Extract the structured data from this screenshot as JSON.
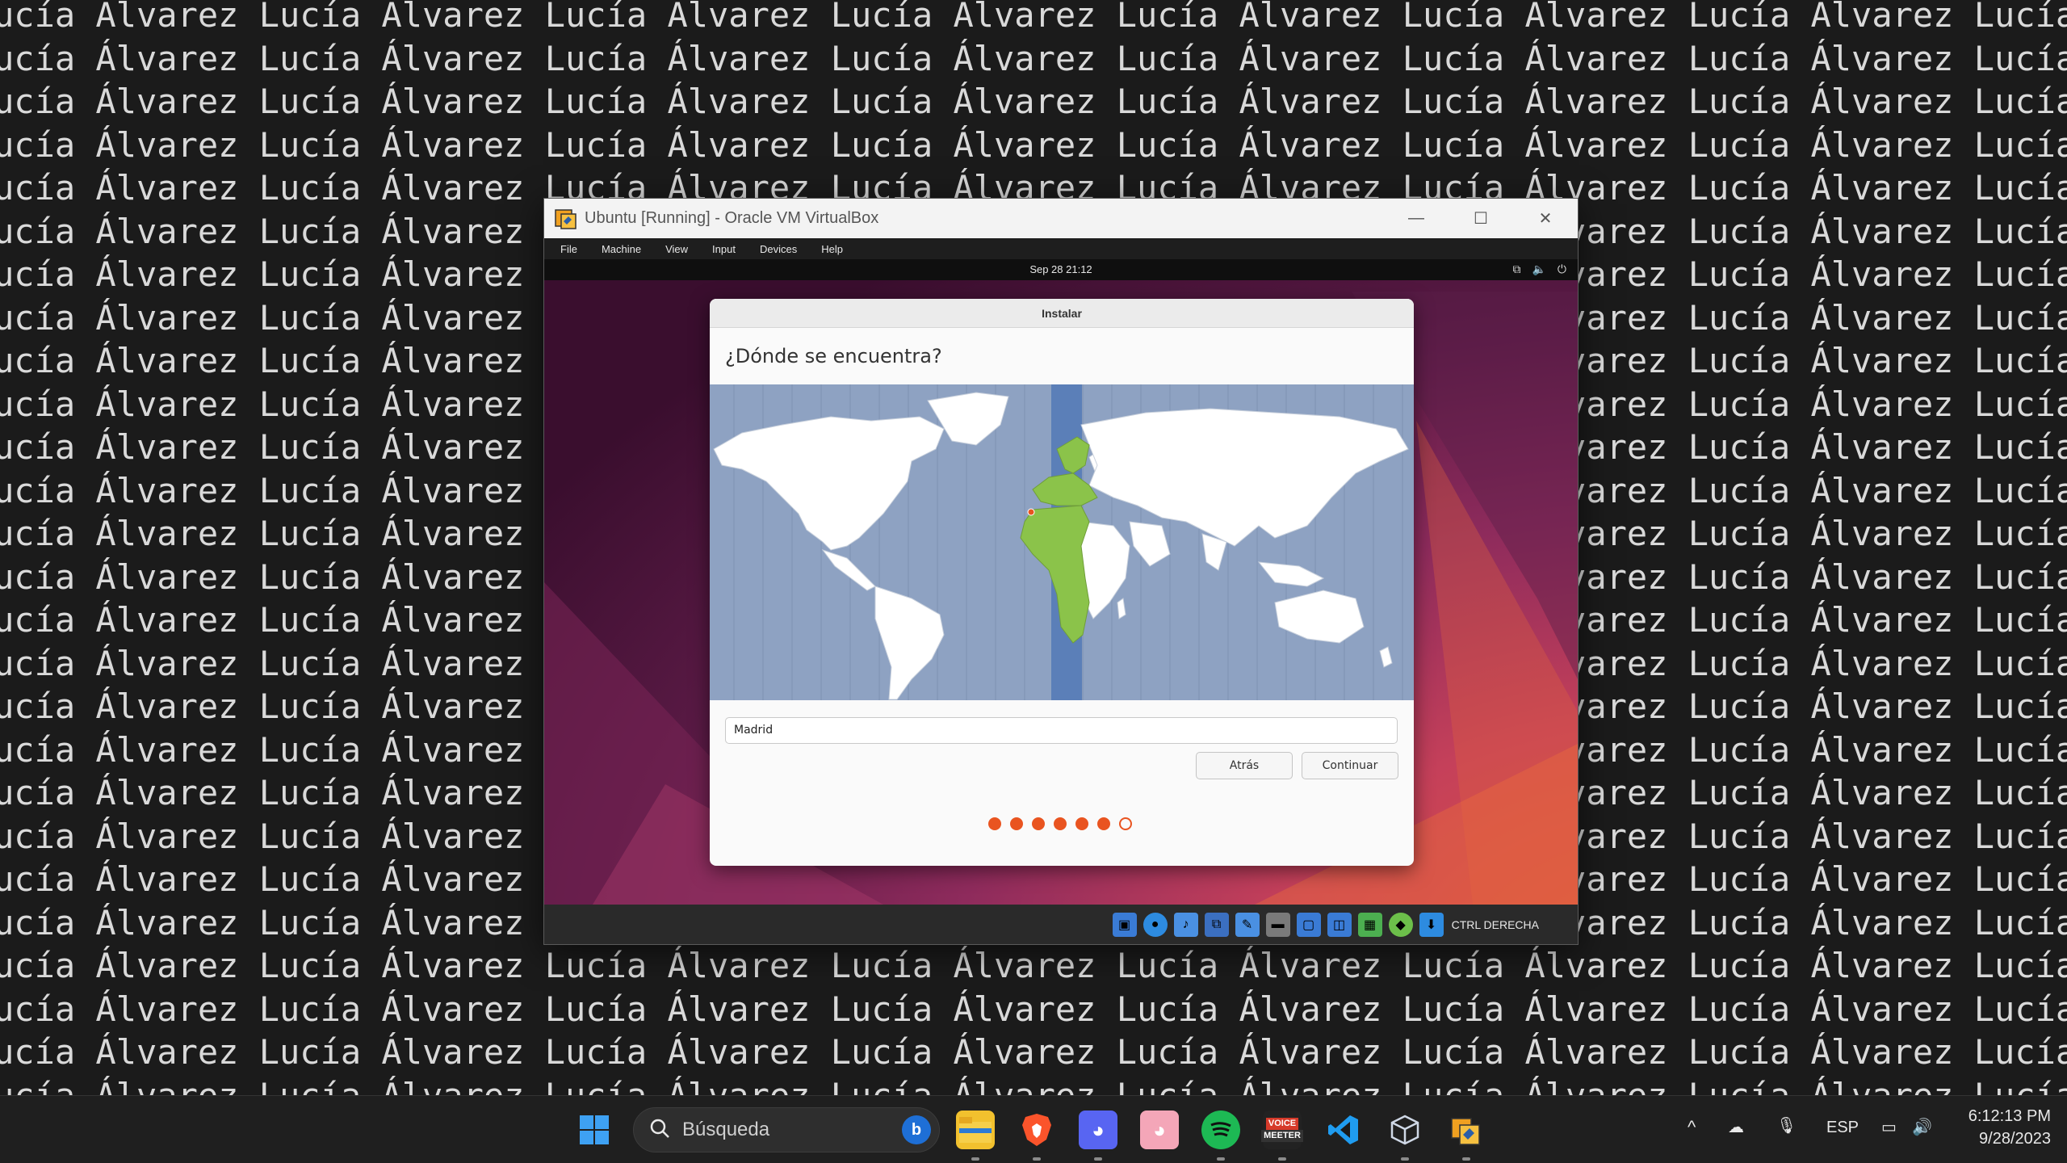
{
  "wallpaper": {
    "rows": [
      "ucía Álvarez Lucía Álvarez Lucía Álvarez Lucía Álvarez Lucía Álvarez Lucía Álvarez Lucía Álvarez Lucía Álvar",
      "ucía Álvarez Lucía Álvarez Lucía Álvarez Lucía Álvarez Lucía Álvarez Lucía Álvarez Lucía Álvarez Lucía Álvare",
      "ucía Álvarez Lucía Álvarez Lucía Álvarez Lucía Álvarez Lucía Álvarez Lucía Álvarez Lucía Álvarez Lucía Álvare",
      "ucía Álvarez Lucía Álvarez Lucía Álvarez Lucía Álvarez Lucía Álvarez Lucía Álvarez Lucía Álvarez Lucía Álvare",
      "ucía Álvarez Lucía Álvarez Lucía Álvarez Lucía Álvarez Lucía Álvarez Lucía Álvarez Lucía Álvarez Lucía Álvare",
      "ucía Álvarez Lucía Álvarez Lucía Álvarez Lucía Álvarez Lucía Álvarez Lucía Álvarez Lucía Álvarez Lucía Álvare",
      "ucía Álvarez Lucía Álvarez Lucía Álvarez Lucía Álvarez Lucía Álvarez Lucía Álvarez Lucía Álvarez Lucía Álvare",
      "ucía Álvarez Lucía Álvarez Lucía Álvarez Lucía Álvarez Lucía Álvarez Lucía Álvarez Lucía Álvarez Lucía Álvare",
      "ucía Álvarez Lucía Álvarez Lucía Álvarez Lucía Álvarez Lucía Álvarez Lucía Álvarez Lucía Álvarez Lucía Álvare",
      "ucía Álvarez Lucía Álvarez Lucía Álvarez Lucía Álvarez Lucía Álvarez Lucía Álvarez Lucía Álvarez Lucía Álvare",
      "ucía Álvarez Lucía Álvarez Lucía Álvarez Lucía Álvarez Lucía Álvarez Lucía Álvarez Lucía Álvarez Lucía Álvare",
      "ucía Álvarez Lucía Álvarez Lucía Álvarez Lucía Álvarez Lucía Álvarez Lucía Álvarez Lucía Álvarez Lucía Álvare",
      "ucía Álvarez Lucía Álvarez Lucía Álvarez Lucía Álvarez Lucía Álvarez Lucía Álvarez Lucía Álvarez Lucía Álvare",
      "ucía Álvarez Lucía Álvarez Lucía Álvarez Lucía Álvarez Lucía Álvarez Lucía Álvarez Lucía Álvarez Lucía Álvare",
      "ucía Álvarez Lucía Álvarez Lucía Álvarez Lucía Álvarez Lucía Álvarez Lucía Álvarez Lucía Álvarez Lucía Álvare",
      "ucía Álvarez Lucía Álvarez Lucía Álvarez Lucía Álvarez Lucía Álvarez Lucía Álvarez Lucía Álvarez Lucía Álvare",
      "ucía Álvarez Lucía Álvarez Lucía Álvarez Lucía Álvarez Lucía Álvarez Lucía Álvarez Lucía Álvarez Lucía Álvare",
      "ucía Álvarez Lucía Álvarez Lucía Álvarez Lucía Álvarez Lucía Álvarez Lucía Álvarez Lucía Álvarez Lucía Álvare",
      "ucía Álvarez Lucía Álvarez Lucía Álvarez Lucía Álvarez Lucía Álvarez Lucía Álvarez Lucía Álvarez Lucía Álvare",
      "ucía Álvarez Lucía Álvarez Lucía Álvarez Lucía Álvarez Lucía Álvarez Lucía Álvarez Lucía Álvarez Lucía Álvare",
      "ucía Álvarez Lucía Álvarez Lucía Álvarez Lucía Álvarez Lucía Álvarez Lucía Álvarez Lucía Álvarez Lucía Álvare",
      "ucía Álvarez Lucía Álvarez Lucía Álvarez Lucía Álvarez Lucía Álvarez Lucía Álvarez Lucía Álvarez Lucía Álvare",
      "ucía Álvarez Lucía Álvarez Lucía Álvarez Lucía Álvarez Lucía Álvarez Lucía Álvarez Lucía Álvarez Lucía Álvare",
      "ucía Álvarez Lucía Álvarez Lucía Álvarez Lucía Álvarez Lucía Álvarez Lucía Álvarez Lucía Álvarez Lucía Álvare",
      "ucía Álvarez Lucía Álvarez Lucía Álvarez Lucía Álvarez Lucía Álvarez Lucía Álvarez Lucía Álvarez Lucía Álvare",
      "ucía Álvarez Lucía Álvarez Lucía Álvarez Lucía Álvarez Lucía Álvarez Lucía Álvarez Lucía Álvarez Lucía Álvare"
    ]
  },
  "vbox": {
    "title": "Ubuntu [Running] - Oracle VM VirtualBox",
    "minimize": "—",
    "maximize": "☐",
    "close": "✕",
    "menu": [
      "File",
      "Machine",
      "View",
      "Input",
      "Devices",
      "Help"
    ],
    "host_key": "CTRL DERECHA",
    "status_icons": [
      "hard-disk-icon",
      "optical-drive-icon",
      "audio-icon",
      "network-icon",
      "usb-icon",
      "shared-folders-icon",
      "display-icon",
      "video-capture-icon",
      "cpu-icon",
      "guest-additions-icon",
      "mouse-integration-icon"
    ]
  },
  "guest": {
    "clock": "Sep 28  21:12",
    "tray": {
      "network": "⧉",
      "volume": "🔈",
      "power": "⏻"
    }
  },
  "installer": {
    "window_title": "Instalar",
    "heading": "¿Dónde se encuentra?",
    "timezone_value": "Madrid",
    "back_label": "Atrás",
    "continue_label": "Continuar",
    "steps_total": 7,
    "steps_completed": 6,
    "colors": {
      "accent": "#e95420",
      "ocean": "#8ea2c2",
      "land": "#ffffff",
      "selected_zone": "#8bc34a",
      "tz_band": "#5b7fb8"
    }
  },
  "taskbar": {
    "search_placeholder": "Búsqueda",
    "apps": [
      "start-icon",
      "file-explorer-icon",
      "brave-icon",
      "discord-icon",
      "discord-alt-icon",
      "spotify-icon",
      "voicemeeter-icon",
      "vscode-icon",
      "virtualbox-icon",
      "virtualbox-manager-icon"
    ],
    "voicemeeter_top": "VOICE",
    "voicemeeter_bottom": "MEETER",
    "language": "ESP",
    "time": "6:12:13 PM",
    "date": "9/28/2023"
  }
}
